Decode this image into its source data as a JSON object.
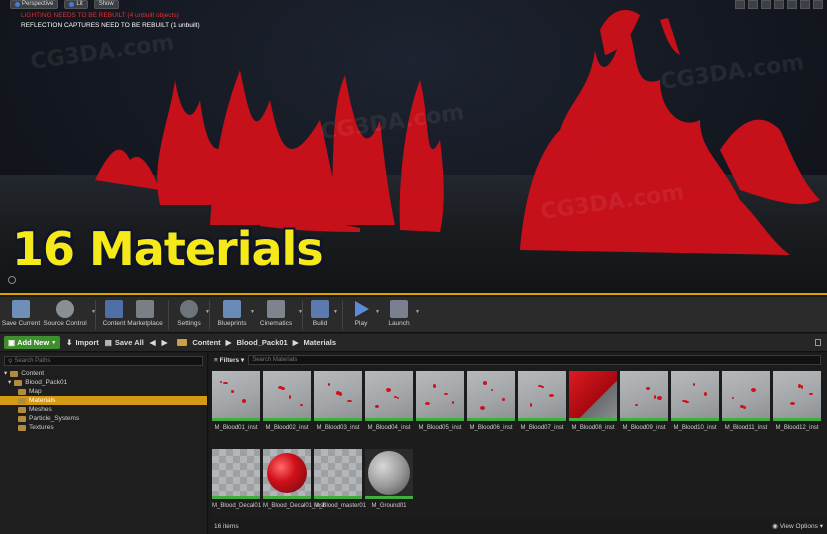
{
  "viewport": {
    "buttons": [
      "Perspective",
      "Lit",
      "Show"
    ],
    "warning_lighting": "LIGHTING NEEDS TO BE REBUILT (4 unbuilt objects)",
    "warning_reflection": "REFLECTION CAPTURES NEED TO BE REBUILT (1 unbuilt)",
    "overlay_title": "16 Materials",
    "watermark": "CG3DA.com"
  },
  "toolbar": {
    "items": [
      {
        "label": "Save Current",
        "icon": "save-icon",
        "color": "#6f8fb8"
      },
      {
        "label": "Source Control",
        "icon": "source-control-icon",
        "color": "#8a8f96"
      },
      {
        "label": "Content",
        "icon": "content-icon",
        "color": "#4f6fa6"
      },
      {
        "label": "Marketplace",
        "icon": "marketplace-icon",
        "color": "#7a7f86"
      },
      {
        "label": "Settings",
        "icon": "settings-icon",
        "color": "#6e747c"
      },
      {
        "label": "Blueprints",
        "icon": "blueprints-icon",
        "color": "#6a8ab8"
      },
      {
        "label": "Cinematics",
        "icon": "cinematics-icon",
        "color": "#7e848c"
      },
      {
        "label": "Build",
        "icon": "build-icon",
        "color": "#5a7ab0"
      },
      {
        "label": "Play",
        "icon": "play-icon",
        "color": "#5a8ad8"
      },
      {
        "label": "Launch",
        "icon": "launch-icon",
        "color": "#7a8090"
      }
    ]
  },
  "content_browser": {
    "add_new": "Add New",
    "import": "Import",
    "save_all": "Save All",
    "path": [
      "Content",
      "Blood_Pack01",
      "Materials"
    ],
    "search_paths_placeholder": "Search Paths",
    "filters": "Filters",
    "search_materials_placeholder": "Search Materials",
    "tree": [
      {
        "label": "Content",
        "level": 0
      },
      {
        "label": "Blood_Pack01",
        "level": 1
      },
      {
        "label": "Map",
        "level": 2
      },
      {
        "label": "Materials",
        "level": 2,
        "selected": true
      },
      {
        "label": "Meshes",
        "level": 2
      },
      {
        "label": "Particle_Systems",
        "level": 2
      },
      {
        "label": "Textures",
        "level": 2
      }
    ],
    "assets": [
      {
        "name": "M_Blood01_inst",
        "style": "plain"
      },
      {
        "name": "M_Blood02_inst",
        "style": "plain"
      },
      {
        "name": "M_Blood03_inst",
        "style": "plain"
      },
      {
        "name": "M_Blood04_inst",
        "style": "plain"
      },
      {
        "name": "M_Blood05_inst",
        "style": "plain"
      },
      {
        "name": "M_Blood06_inst",
        "style": "plain"
      },
      {
        "name": "M_Blood07_inst",
        "style": "plain"
      },
      {
        "name": "M_Blood08_inst",
        "style": "red"
      },
      {
        "name": "M_Blood09_inst",
        "style": "plain"
      },
      {
        "name": "M_Blood10_inst",
        "style": "plain"
      },
      {
        "name": "M_Blood11_inst",
        "style": "plain"
      },
      {
        "name": "M_Blood12_inst",
        "style": "plain"
      },
      {
        "name": "M_Blood_Decal01",
        "style": "checker"
      },
      {
        "name": "M_Blood_Decal01_inst",
        "style": "sphere"
      },
      {
        "name": "M_Blood_master01",
        "style": "checker"
      },
      {
        "name": "M_Ground01",
        "style": "ground"
      }
    ],
    "item_count": "16 items",
    "view_options": "View Options"
  }
}
